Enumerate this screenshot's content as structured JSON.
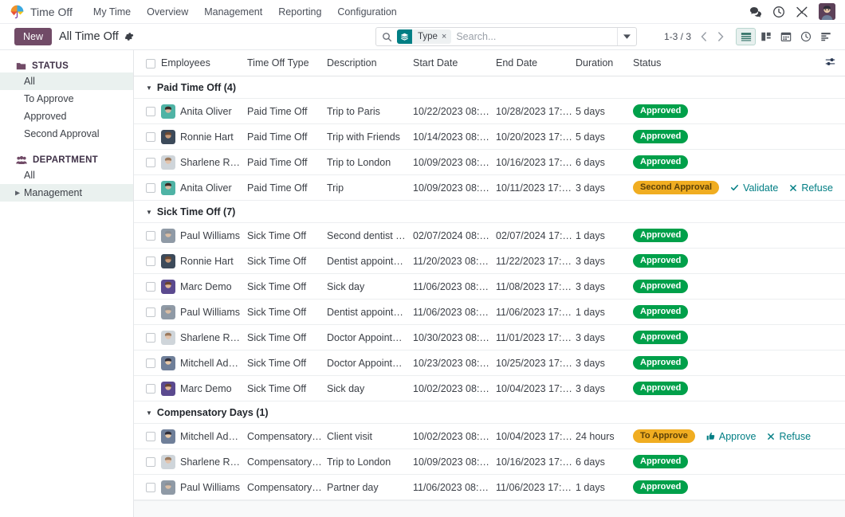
{
  "navbar": {
    "brand": "Time Off",
    "brand_logo_icon": "umbrella-icon",
    "links": [
      "My Time",
      "Overview",
      "Management",
      "Reporting",
      "Configuration"
    ],
    "icons": [
      "messages-icon",
      "clock-icon",
      "tools-icon"
    ],
    "avatar_icon": "user-avatar"
  },
  "control_panel": {
    "new_label": "New",
    "breadcrumb": "All Time Off",
    "gear_icon": "gear-icon",
    "search": {
      "search_icon": "search-icon",
      "facet_icon": "layers-icon",
      "facet_label": "Type",
      "facet_remove": "×",
      "placeholder": "Search...",
      "value": "",
      "dropdown_icon": "caret-down-icon"
    },
    "pager": {
      "count": "1-3 / 3",
      "prev_icon": "chevron-left-icon",
      "next_icon": "chevron-right-icon"
    },
    "views": [
      {
        "name": "list-view",
        "icon": "list-icon",
        "active": true
      },
      {
        "name": "kanban-view",
        "icon": "kanban-icon",
        "active": false
      },
      {
        "name": "calendar-view",
        "icon": "calendar-icon",
        "active": false
      },
      {
        "name": "activity-view",
        "icon": "clock-icon",
        "active": false
      },
      {
        "name": "gantt-view",
        "icon": "gantt-icon",
        "active": false
      }
    ]
  },
  "sidebar": {
    "sections": [
      {
        "title": "STATUS",
        "icon": "folder-icon",
        "items": [
          {
            "label": "All",
            "active": true,
            "caret": false
          },
          {
            "label": "To Approve",
            "active": false,
            "caret": false
          },
          {
            "label": "Approved",
            "active": false,
            "caret": false
          },
          {
            "label": "Second Approval",
            "active": false,
            "caret": false
          }
        ]
      },
      {
        "title": "DEPARTMENT",
        "icon": "people-icon",
        "items": [
          {
            "label": "All",
            "active": false,
            "caret": false
          },
          {
            "label": "Management",
            "active": true,
            "caret": true
          }
        ]
      }
    ]
  },
  "table": {
    "columns": [
      "Employees",
      "Time Off Type",
      "Description",
      "Start Date",
      "End Date",
      "Duration",
      "Status"
    ],
    "options_icon": "sliders-icon",
    "groups": [
      {
        "label": "Paid Time Off (4)",
        "rows": [
          {
            "employee": "Anita Oliver",
            "avatar": "anita",
            "type": "Paid Time Off",
            "description": "Trip to Paris",
            "start": "10/22/2023 08:00:...",
            "end": "10/28/2023 17:00:...",
            "duration": "5 days",
            "status": "Approved",
            "status_style": "success",
            "actions": []
          },
          {
            "employee": "Ronnie Hart",
            "avatar": "ronnie",
            "type": "Paid Time Off",
            "description": "Trip with Friends",
            "start": "10/14/2023 08:00:...",
            "end": "10/20/2023 17:00:...",
            "duration": "5 days",
            "status": "Approved",
            "status_style": "success",
            "actions": []
          },
          {
            "employee": "Sharlene Rhodes",
            "avatar": "sharlene",
            "type": "Paid Time Off",
            "description": "Trip to London",
            "start": "10/09/2023 08:00:...",
            "end": "10/16/2023 17:00:...",
            "duration": "6 days",
            "status": "Approved",
            "status_style": "success",
            "actions": []
          },
          {
            "employee": "Anita Oliver",
            "avatar": "anita",
            "type": "Paid Time Off",
            "description": "Trip",
            "start": "10/09/2023 08:00:...",
            "end": "10/11/2023 17:00:...",
            "duration": "3 days",
            "status": "Second Approval",
            "status_style": "warning",
            "actions": [
              {
                "label": "Validate",
                "icon": "check-icon"
              },
              {
                "label": "Refuse",
                "icon": "cross-icon"
              }
            ]
          }
        ]
      },
      {
        "label": "Sick Time Off (7)",
        "rows": [
          {
            "employee": "Paul Williams",
            "avatar": "paul",
            "type": "Sick Time Off",
            "description": "Second dentist app...",
            "start": "02/07/2024 08:00:...",
            "end": "02/07/2024 17:00:...",
            "duration": "1 days",
            "status": "Approved",
            "status_style": "success",
            "actions": []
          },
          {
            "employee": "Ronnie Hart",
            "avatar": "ronnie",
            "type": "Sick Time Off",
            "description": "Dentist appointment",
            "start": "11/20/2023 08:00:...",
            "end": "11/22/2023 17:00:...",
            "duration": "3 days",
            "status": "Approved",
            "status_style": "success",
            "actions": []
          },
          {
            "employee": "Marc Demo",
            "avatar": "marc",
            "type": "Sick Time Off",
            "description": "Sick day",
            "start": "11/06/2023 08:00:...",
            "end": "11/08/2023 17:00:...",
            "duration": "3 days",
            "status": "Approved",
            "status_style": "success",
            "actions": []
          },
          {
            "employee": "Paul Williams",
            "avatar": "paul",
            "type": "Sick Time Off",
            "description": "Dentist appointment",
            "start": "11/06/2023 08:00:...",
            "end": "11/06/2023 17:00:...",
            "duration": "1 days",
            "status": "Approved",
            "status_style": "success",
            "actions": []
          },
          {
            "employee": "Sharlene Rhodes",
            "avatar": "sharlene",
            "type": "Sick Time Off",
            "description": "Doctor Appointment",
            "start": "10/30/2023 08:00:...",
            "end": "11/01/2023 17:00:...",
            "duration": "3 days",
            "status": "Approved",
            "status_style": "success",
            "actions": []
          },
          {
            "employee": "Mitchell Admin",
            "avatar": "mitchell",
            "type": "Sick Time Off",
            "description": "Doctor Appointment",
            "start": "10/23/2023 08:00:...",
            "end": "10/25/2023 17:00:...",
            "duration": "3 days",
            "status": "Approved",
            "status_style": "success",
            "actions": []
          },
          {
            "employee": "Marc Demo",
            "avatar": "marc",
            "type": "Sick Time Off",
            "description": "Sick day",
            "start": "10/02/2023 08:00:...",
            "end": "10/04/2023 17:00:...",
            "duration": "3 days",
            "status": "Approved",
            "status_style": "success",
            "actions": []
          }
        ]
      },
      {
        "label": "Compensatory Days (1)",
        "rows": [
          {
            "employee": "Mitchell Admin",
            "avatar": "mitchell",
            "type": "Compensatory Days",
            "description": "Client visit",
            "start": "10/02/2023 08:00:...",
            "end": "10/04/2023 17:00:...",
            "duration": "24 hours",
            "status": "To Approve",
            "status_style": "warning",
            "actions": [
              {
                "label": "Approve",
                "icon": "thumbs-up-icon"
              },
              {
                "label": "Refuse",
                "icon": "cross-icon"
              }
            ]
          },
          {
            "employee": "Sharlene Rhodes",
            "avatar": "sharlene",
            "type": "Compensatory Days",
            "description": "Trip to London",
            "start": "10/09/2023 08:00:...",
            "end": "10/16/2023 17:00:...",
            "duration": "6 days",
            "status": "Approved",
            "status_style": "success",
            "actions": []
          },
          {
            "employee": "Paul Williams",
            "avatar": "paul",
            "type": "Compensatory Days",
            "description": "Partner day",
            "start": "11/06/2023 08:00:...",
            "end": "11/06/2023 17:00:...",
            "duration": "1 days",
            "status": "Approved",
            "status_style": "success",
            "actions": []
          }
        ]
      }
    ]
  },
  "colors": {
    "brand_purple": "#714B67",
    "accent_teal": "#017e84",
    "success_green": "#00A04A",
    "warning_orange": "#F0AD21"
  }
}
